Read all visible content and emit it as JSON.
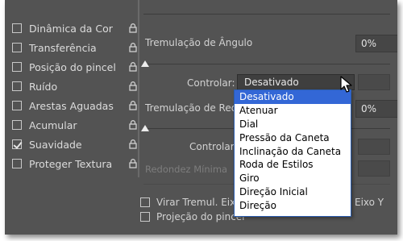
{
  "sidebar": {
    "items": [
      {
        "label": "Dinâmica da Cor",
        "checked": false
      },
      {
        "label": "Transferência",
        "checked": false
      },
      {
        "label": "Posição do pincel",
        "checked": false
      },
      {
        "label": "Ruído",
        "checked": false
      },
      {
        "label": "Arestas Aguadas",
        "checked": false
      },
      {
        "label": "Acumular",
        "checked": false
      },
      {
        "label": "Suavidade",
        "checked": true
      },
      {
        "label": "Proteger Textura",
        "checked": false
      }
    ],
    "lock_icon": "lock-icon"
  },
  "angle_jitter": {
    "label": "Tremulação de Ângulo",
    "value": "0%",
    "control_label": "Controlar:",
    "control_value": "Desativado"
  },
  "roundness_jitter": {
    "label": "Tremulação de Redo",
    "value": "0%",
    "control_label": "Controlar:",
    "min_label": "Redondez Mínima"
  },
  "checkboxes": {
    "flip_x": "Virar Tremul. Eixo",
    "flip_y_tail": "Eixo Y",
    "projection": "Projeção do pincel"
  },
  "dropdown": {
    "selected_index": 0,
    "options": [
      "Desativado",
      "Atenuar",
      "Dial",
      "Pressão da Caneta",
      "Inclinação da Caneta",
      "Roda de Estilos",
      "Giro",
      "Direção Inicial",
      "Direção"
    ]
  },
  "colors": {
    "panel_bg": "#535353",
    "highlight": "#3367d6"
  }
}
